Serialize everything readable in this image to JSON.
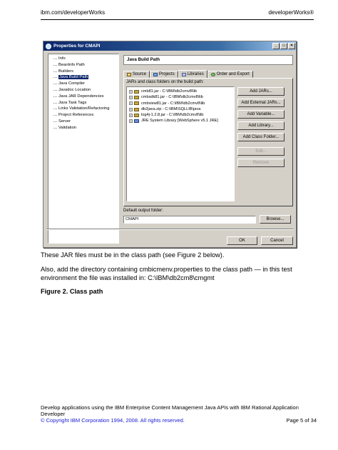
{
  "header": {
    "left": "ibm.com/developerWorks",
    "right": "developerWorks®"
  },
  "dialog": {
    "title": "Properties for CMAPI",
    "tree": [
      "Info",
      "BeanInfo Path",
      "Builders",
      "Java Build Path",
      "Java Compiler",
      "Javadoc Location",
      "Java JAR Dependencies",
      "Java Task Tags",
      "Links Validation/Refactoring",
      "Project References",
      "Server",
      "Validation"
    ],
    "panel_title": "Java Build Path",
    "tabs": [
      "Source",
      "Projects",
      "Libraries",
      "Order and Export"
    ],
    "jars_label": "JARs and class folders on the build path:",
    "jars": [
      "cmb81.jar - C:\\IBM\\db2cmv8\\lib",
      "cmbsdk81.jar - C:\\IBM\\db2cmv8\\lib",
      "cmbview81.jar - C:\\IBM\\db2cmv8\\lib",
      "db2java.zip - C:\\IBM\\SQLLIB\\java",
      "log4j-1.2.8.jar - C:\\IBM\\db2cmv8\\lib",
      "JRE System Library [WebSphere v5.1 JRE]"
    ],
    "buttons": {
      "add_jars": "Add JARs...",
      "add_external_jars": "Add External JARs...",
      "add_variable": "Add Variable...",
      "add_library": "Add Library...",
      "add_class_folder": "Add Class Folder...",
      "edit": "Edit...",
      "remove": "Remove",
      "browse": "Browse...",
      "ok": "OK",
      "cancel": "Cancel"
    },
    "output_label": "Default output folder:",
    "output_value": "CMAPI"
  },
  "body": {
    "p1": "These JAR files must be in the class path (see Figure 2 below).",
    "p2": "Also, add the directory containing cmbicmenv.properties to the class path — in this test environment the file was installed in: C:\\IBM\\db2cm8\\cmgmt",
    "figure_title": "Figure 2. Class path"
  },
  "footer": {
    "line1": "Develop applications using the IBM Enterprise Content Management Java APIs with IBM Rational Application Developer",
    "copyright": "© Copyright IBM Corporation 1994, 2008. All rights reserved.",
    "page": "Page 5 of 34"
  }
}
